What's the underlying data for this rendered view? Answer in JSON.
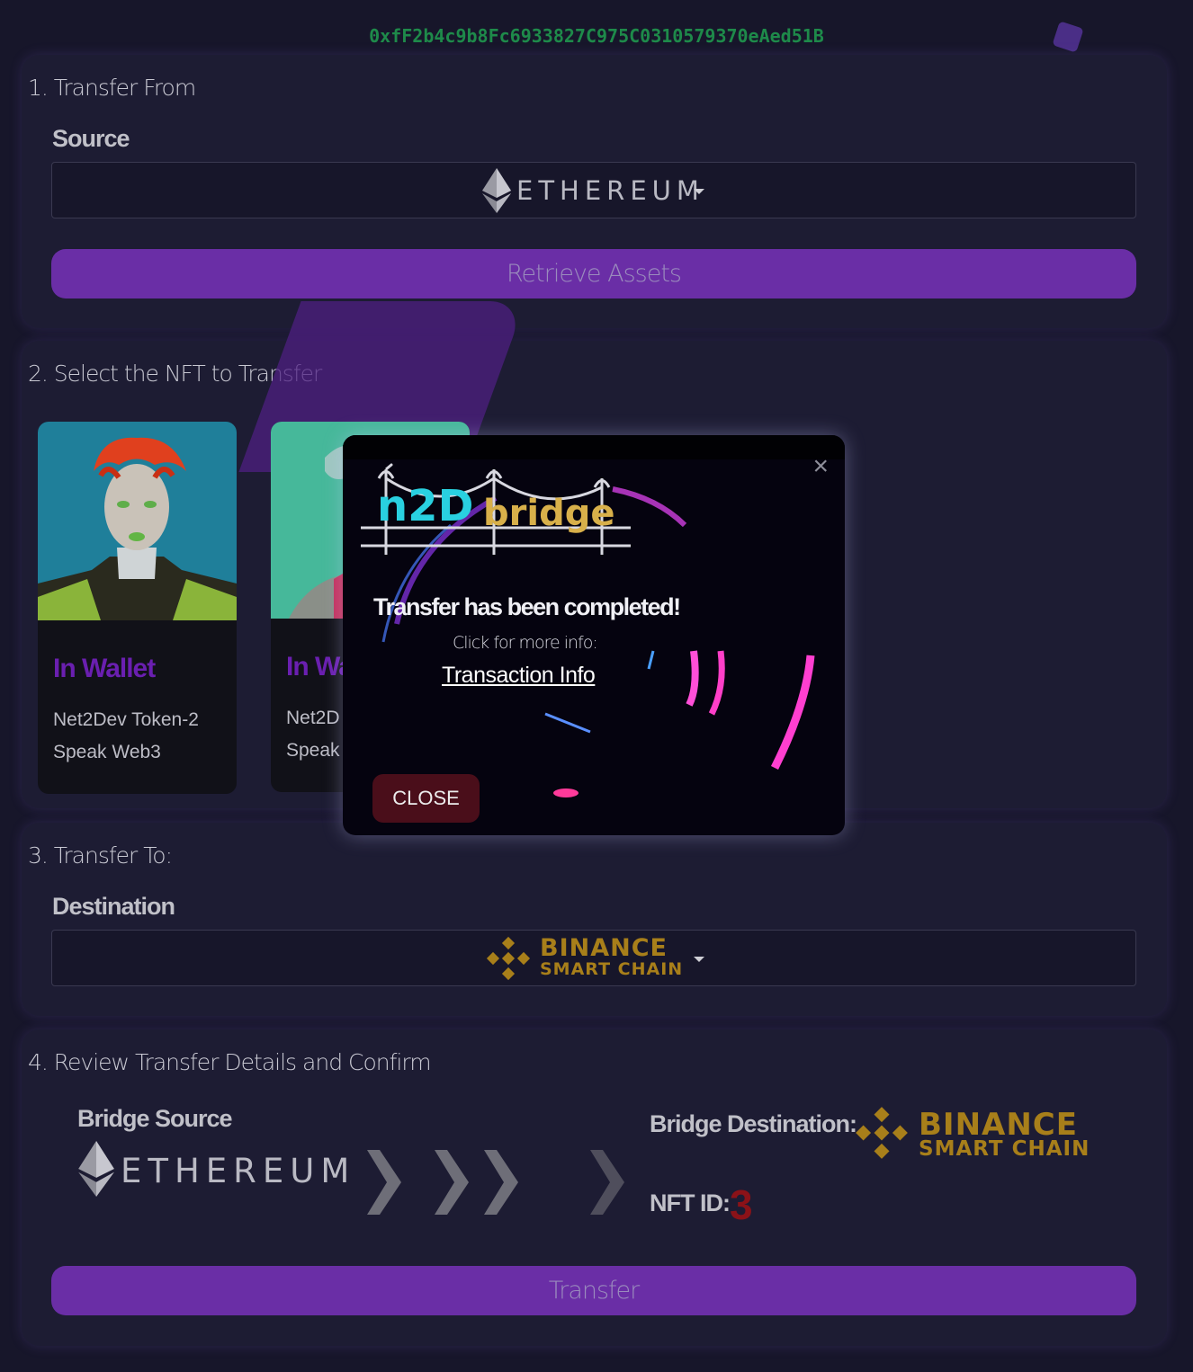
{
  "wallet_address": "0xfF2b4c9b8Fc6933827C975C0310579370eAed51B",
  "step1": {
    "title": "1. Transfer From",
    "source_label": "Source",
    "source_value": "ETHEREUM",
    "retrieve_button": "Retrieve Assets"
  },
  "step2": {
    "title": "2. Select the NFT to Transfer",
    "cards": [
      {
        "status": "In Wallet",
        "name": "Net2Dev Token-2",
        "collection": "Speak Web3"
      },
      {
        "status": "In Wa",
        "name": "Net2D",
        "collection": "Speak V"
      }
    ]
  },
  "step3": {
    "title": "3. Transfer To:",
    "destination_label": "Destination",
    "destination_line1": "BINANCE",
    "destination_line2": "SMART CHAIN"
  },
  "step4": {
    "title": "4. Review Transfer Details and Confirm",
    "bridge_source_label": "Bridge Source",
    "bridge_source_value": "ETHEREUM",
    "bridge_destination_label": "Bridge Destination:",
    "bridge_destination_line1": "BINANCE",
    "bridge_destination_line2": "SMART CHAIN",
    "nft_id_label": "NFT ID:",
    "nft_id_value": "3",
    "transfer_button": "Transfer"
  },
  "modal": {
    "logo_left": "n2D",
    "logo_right": "bridge",
    "message": "Transfer has been completed!",
    "sub": "Click for more info:",
    "link": "Transaction Info",
    "close_button": "CLOSE",
    "close_icon": "×"
  },
  "colors": {
    "background": "#17162a",
    "panel": "#1d1c33",
    "accent_purple": "#6a2ea6",
    "wallet_green": "#1e8a4a",
    "binance_gold": "#a87f1a",
    "nft_id_red": "#8b1218"
  }
}
